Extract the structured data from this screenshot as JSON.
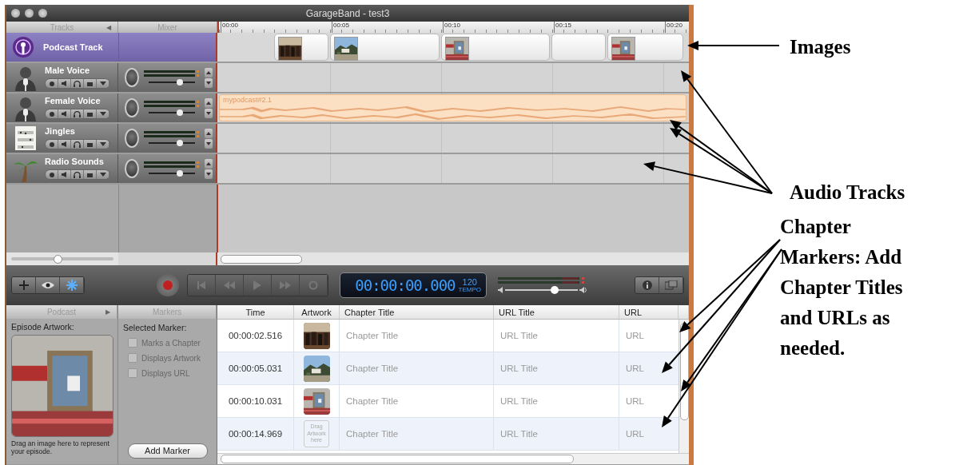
{
  "window": {
    "title": "GarageBand - test3"
  },
  "headers": {
    "tracks": "Tracks",
    "tracks_toggle": "◀",
    "mixer": "Mixer"
  },
  "zoom_slider": {
    "level": 0.45
  },
  "ruler": [
    "00:00",
    "00:05",
    "00:10",
    "00:15",
    "00:20"
  ],
  "podcast_track": {
    "name": "Podcast Track",
    "segments": [
      {
        "kind": "picture"
      },
      {
        "kind": "picture"
      },
      {
        "kind": "picture"
      },
      {
        "kind": "empty"
      },
      {
        "kind": "picture"
      }
    ]
  },
  "tracks": [
    {
      "name": "Male Voice",
      "kind": "voice",
      "level": 0.68
    },
    {
      "name": "Female Voice",
      "kind": "voice",
      "level": 0.68,
      "region": {
        "name": "mypodcast#2.1"
      }
    },
    {
      "name": "Jingles",
      "kind": "sheet",
      "level": 0.68
    },
    {
      "name": "Radio Sounds",
      "kind": "tree",
      "level": 0.68
    }
  ],
  "transport": {
    "time": "00:00:00.000",
    "tempo": "120",
    "tempo_label": "TEMPO",
    "level": 0.68
  },
  "podcast_pane": {
    "header": "Podcast",
    "toggle": "▶",
    "artwork_label": "Episode Artwork:",
    "artwork": {
      "kind": "picture"
    },
    "hint": "Drag an image here to represent your episode."
  },
  "markers_pane": {
    "header": "Markers",
    "label": "Selected Marker:",
    "options": [
      {
        "label": "Marks a Chapter",
        "checked": false,
        "disabled": true
      },
      {
        "label": "Displays Artwork",
        "checked": false,
        "disabled": true
      },
      {
        "label": "Displays URL",
        "checked": false,
        "disabled": true
      }
    ],
    "button": "Add Marker"
  },
  "table": {
    "columns": [
      "Time",
      "Artwork",
      "Chapter Title",
      "URL Title",
      "URL"
    ],
    "rows": [
      {
        "time": "00:00:02.516",
        "artwork": {
          "kind": "picture"
        },
        "chapter_title": "Chapter Title",
        "url_title": "URL Title",
        "url": "URL"
      },
      {
        "time": "00:00:05.031",
        "artwork": {
          "kind": "picture"
        },
        "chapter_title": "Chapter Title",
        "url_title": "URL Title",
        "url": "URL"
      },
      {
        "time": "00:00:10.031",
        "artwork": {
          "kind": "picture"
        },
        "chapter_title": "Chapter Title",
        "url_title": "URL Title",
        "url": "URL"
      },
      {
        "time": "00:00:14.969",
        "artwork": {
          "kind": "placeholder",
          "text": "Drag Artwork here"
        },
        "chapter_title": "Chapter Title",
        "url_title": "URL Title",
        "url": "URL"
      }
    ]
  },
  "annotations": [
    {
      "text": "Images"
    },
    {
      "text": "Audio Tracks"
    },
    {
      "text": "Chapter Markers: Add Chapter Titles and URLs as needed."
    }
  ]
}
